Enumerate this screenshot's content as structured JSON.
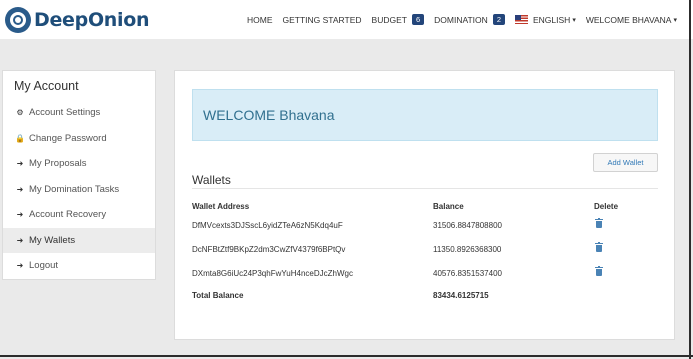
{
  "brand": {
    "name": "DeepOnion"
  },
  "nav": {
    "home": "HOME",
    "getting_started": "GETTING STARTED",
    "budget": "BUDGET",
    "budget_count": "6",
    "domination": "DOMINATION",
    "domination_count": "2",
    "language": "ENGLISH",
    "user": "WELCOME BHAVANA"
  },
  "sidebar": {
    "title": "My Account",
    "items": [
      {
        "label": "Account Settings",
        "icon": "gear-icon"
      },
      {
        "label": "Change Password",
        "icon": "lock-icon"
      },
      {
        "label": "My Proposals",
        "icon": "sign-in-icon"
      },
      {
        "label": "My Domination Tasks",
        "icon": "sign-in-icon"
      },
      {
        "label": "Account Recovery",
        "icon": "sign-in-icon"
      },
      {
        "label": "My Wallets",
        "icon": "sign-in-icon",
        "active": true
      },
      {
        "label": "Logout",
        "icon": "sign-in-icon"
      }
    ]
  },
  "main": {
    "welcome": "WELCOME Bhavana",
    "add_wallet_label": "Add Wallet",
    "wallets_heading": "Wallets",
    "columns": {
      "address": "Wallet Address",
      "balance": "Balance",
      "delete": "Delete"
    },
    "rows": [
      {
        "address": "DfMVcexts3DJSscL6yidZTeA6zN5Kdq4uF",
        "balance": "31506.8847808800"
      },
      {
        "address": "DcNFBtZtf9BKpZ2dm3CwZfV4379f6BPtQv",
        "balance": "11350.8926368300"
      },
      {
        "address": "DXmta8G6iUc24P3qhFwYuH4nceDJcZhWgc",
        "balance": "40576.8351537400"
      }
    ],
    "total_label": "Total Balance",
    "total_value": "83434.6125715"
  },
  "colors": {
    "brand": "#1f4e7a",
    "badge": "#23457a",
    "welcome_bg": "#d9edf7",
    "welcome_text": "#31708f",
    "link": "#337ab7"
  }
}
